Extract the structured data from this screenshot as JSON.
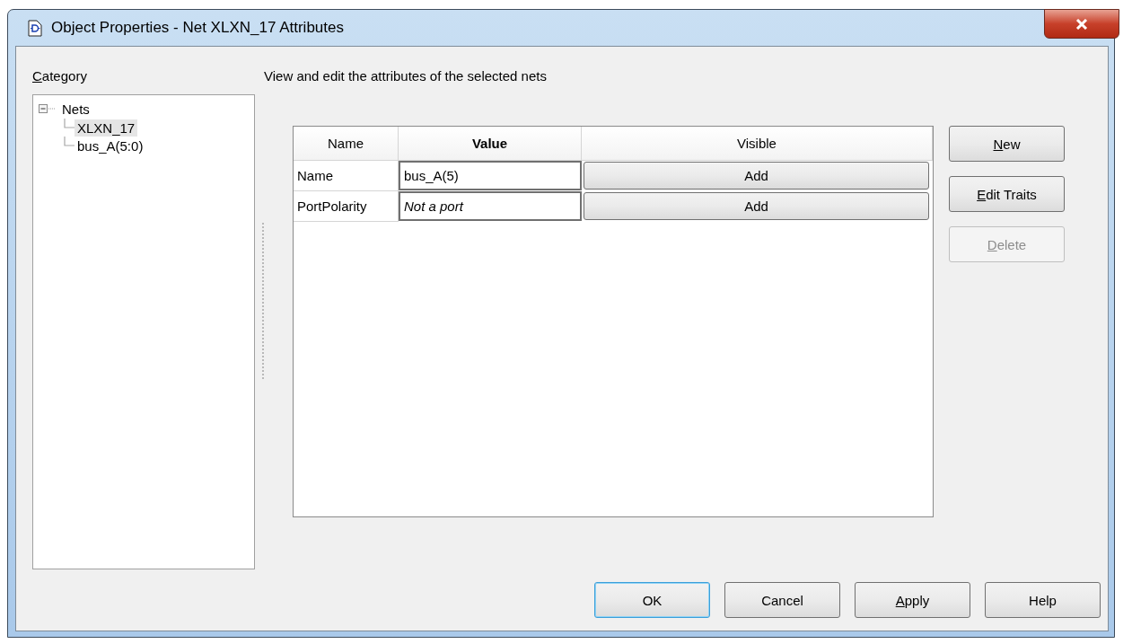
{
  "window": {
    "title": "Object Properties - Net XLXN_17 Attributes"
  },
  "category": {
    "label": "Category",
    "access_key_shown": true,
    "tree": [
      {
        "label": "Nets",
        "expanded": true,
        "children": [
          {
            "label": "XLXN_17",
            "selected": true
          },
          {
            "label": "bus_A(5:0)",
            "selected": false
          }
        ]
      }
    ]
  },
  "description": "View and edit the attributes of the selected nets",
  "table": {
    "columns": [
      {
        "label": "Name",
        "emphasized": false
      },
      {
        "label": "Value",
        "emphasized": true
      },
      {
        "label": "Visible",
        "emphasized": false
      }
    ],
    "rows": [
      {
        "name": "Name",
        "value": "bus_A(5)",
        "italic": false,
        "visible": "Add"
      },
      {
        "name": "PortPolarity",
        "value": "Not a port",
        "italic": true,
        "visible": "Add"
      }
    ]
  },
  "side_buttons": [
    {
      "label": "New",
      "access_key_shown": true,
      "disabled": false
    },
    {
      "label": "Edit Traits",
      "access_key_shown": true,
      "disabled": false
    },
    {
      "label": "Delete",
      "access_key_shown": true,
      "disabled": true
    }
  ],
  "footer_buttons": [
    {
      "label": "OK",
      "default": true
    },
    {
      "label": "Cancel",
      "default": false
    },
    {
      "label": "Apply",
      "access_key_shown": true,
      "default": false
    },
    {
      "label": "Help",
      "default": false
    }
  ]
}
